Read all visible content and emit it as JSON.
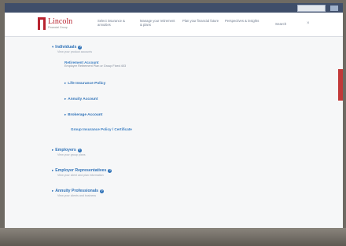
{
  "topbar": {
    "util_labels": [
      "",
      "",
      ""
    ]
  },
  "header": {
    "logo_name": "Lincoln",
    "logo_sub": "Financial Group",
    "nav": [
      "Select insurance & annuities",
      "Manage your retirement & plans",
      "Plan your financial future",
      "Perspectives & insights"
    ],
    "search_label": "Search",
    "close_glyph": "×"
  },
  "sections": {
    "individuals": {
      "title": "Individuals",
      "subtitle": "View your product accounts",
      "retirement_link": "Retirement Account",
      "retirement_desc": "Employer Retirement Plan or Group Fixed 403",
      "life": "Life Insurance Policy",
      "annuity": "Annuity Account",
      "brokerage": "Brokerage Account",
      "group": "Group Insurance Policy / Certificate"
    },
    "employers": {
      "title": "Employers",
      "subtitle": "View your group plans"
    },
    "employee_reps": {
      "title": "Employer Representatives",
      "subtitle": "View your client and plan information"
    },
    "annuity_pros": {
      "title": "Annuity Professionals",
      "subtitle": "View your clients and business"
    }
  },
  "colors": {
    "brand": "#b8232f",
    "link": "#2f72b8",
    "topbar": "#3f4e6a"
  }
}
